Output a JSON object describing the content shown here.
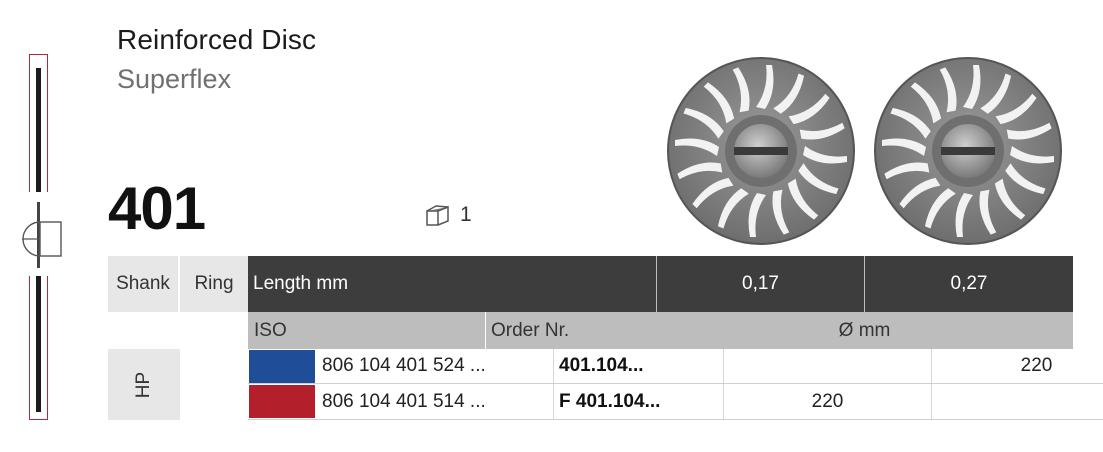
{
  "product": {
    "title": "Reinforced Disc",
    "subtitle": "Superflex",
    "number": "401",
    "pack_quantity": "1",
    "pack_icon": "box-icon"
  },
  "table": {
    "headers": {
      "shank": "Shank",
      "ring": "Ring",
      "length": "Length mm",
      "diam_1": "0,17",
      "diam_2": "0,27",
      "iso": "ISO",
      "order": "Order Nr.",
      "dmm": "Ø mm"
    },
    "shank_type": "HP",
    "rows": [
      {
        "ring_color": "#1f4d97",
        "iso": "806 104 401 524 ...",
        "order": "401.104...",
        "v1": "",
        "v2": "220"
      },
      {
        "ring_color": "#b41f2c",
        "iso": "806 104 401 514 ...",
        "order": "F 401.104...",
        "v1": "220",
        "v2": ""
      }
    ]
  },
  "colors": {
    "header_dark": "#3d3d3d",
    "header_mid": "#bdbdbd",
    "header_light": "#e7e7e7",
    "outline_red": "#b3283a"
  }
}
